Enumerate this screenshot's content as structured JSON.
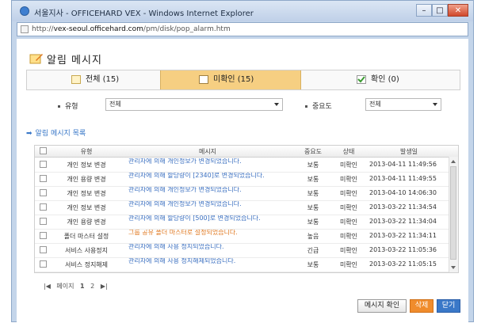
{
  "window": {
    "title": "서울지사 - OFFICEHARD VEX - Windows Internet Explorer",
    "url_prefix": "http://",
    "url_domain": "vex-seoul.officehard.com",
    "url_path": "/pm/disk/pop_alarm.htm",
    "min_label": "–",
    "max_label": "□",
    "close_label": "✕"
  },
  "header": {
    "title": "알림 메시지"
  },
  "tabs": [
    {
      "label": "전체 (15)"
    },
    {
      "label": "미확인 (15)"
    },
    {
      "label": "확인 (0)"
    }
  ],
  "filters": {
    "type_label": "유형",
    "type_value": "전체",
    "priority_label": "중요도",
    "priority_value": "전체"
  },
  "list": {
    "title": "알림 메시지 목록",
    "columns": [
      "유형",
      "메시지",
      "중요도",
      "상태",
      "발생일"
    ],
    "rows": [
      {
        "type": "개인 정보 변경",
        "message": "관리자에 의해 개인정보가 변경되었습니다.",
        "priority": "보통",
        "status": "미확인",
        "date": "2013-04-11 11:49:56"
      },
      {
        "type": "개인 용량 변경",
        "message": "관리자에 의해 할당량이 [2340]로 변경되었습니다.",
        "priority": "보통",
        "status": "미확인",
        "date": "2013-04-11 11:49:55"
      },
      {
        "type": "개인 정보 변경",
        "message": "관리자에 의해 개인정보가 변경되었습니다.",
        "priority": "보통",
        "status": "미확인",
        "date": "2013-04-10 14:06:30"
      },
      {
        "type": "개인 정보 변경",
        "message": "관리자에 의해 개인정보가 변경되었습니다.",
        "priority": "보통",
        "status": "미확인",
        "date": "2013-03-22 11:34:54"
      },
      {
        "type": "개인 용량 변경",
        "message": "관리자에 의해 할당량이 [500]로 변경되었습니다.",
        "priority": "보통",
        "status": "미확인",
        "date": "2013-03-22 11:34:04"
      },
      {
        "type": "폴더 마스터 설정",
        "message": "그룹 공유 폴더 마스터로 설정되었습니다.",
        "priority": "높음",
        "status": "미확인",
        "date": "2013-03-22 11:34:11"
      },
      {
        "type": "서비스 사용정지",
        "message": "관리자에 의해 사용 정지되었습니다.",
        "priority": "긴급",
        "status": "미확인",
        "date": "2013-03-22 11:05:36"
      },
      {
        "type": "서비스 정지해제",
        "message": "관리자에 의해 사용 정지해제되었습니다.",
        "priority": "보통",
        "status": "미확인",
        "date": "2013-03-22 11:05:15"
      }
    ]
  },
  "pager": {
    "first": "|◀",
    "prev": "페이지",
    "current": "1",
    "next": "2",
    "last": "▶|"
  },
  "buttons": {
    "confirm": "메시지 확인",
    "delete": "삭제",
    "close": "닫기"
  },
  "colors": {
    "accent_tab": "#f6cf82",
    "link": "#3a6fc0",
    "highlight_msg": "#e07820",
    "delete_btn": "#f08c2c",
    "close_btn": "#3a78c8"
  }
}
